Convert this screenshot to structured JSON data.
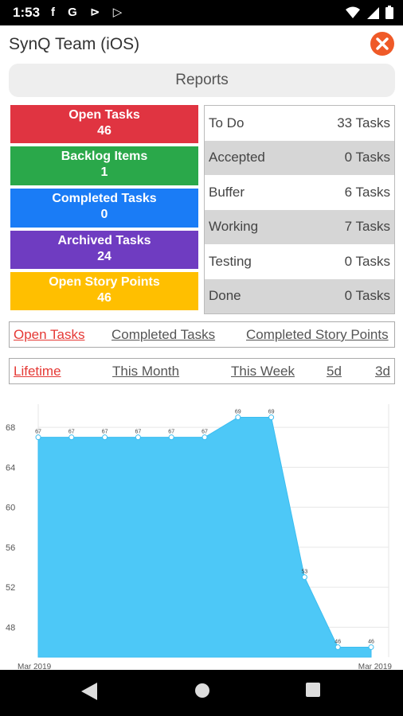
{
  "statusbar": {
    "time": "1:53",
    "icons": [
      "facebook-icon",
      "g-icon",
      "send-icon",
      "play-icon"
    ],
    "notif_glyphs": "f G ⊳ ▷"
  },
  "header": {
    "title": "SynQ Team (iOS)",
    "reports_label": "Reports"
  },
  "tiles": [
    {
      "label": "Open Tasks",
      "value": "46",
      "color": "#e03441"
    },
    {
      "label": "Backlog Items",
      "value": "1",
      "color": "#2aa84a"
    },
    {
      "label": "Completed Tasks",
      "value": "0",
      "color": "#1a7cf6"
    },
    {
      "label": "Archived Tasks",
      "value": "24",
      "color": "#6f3cc1"
    },
    {
      "label": "Open Story Points",
      "value": "46",
      "color": "#ffbf00"
    }
  ],
  "status_rows": [
    {
      "name": "To Do",
      "count": "33 Tasks"
    },
    {
      "name": "Accepted",
      "count": "0 Tasks"
    },
    {
      "name": "Buffer",
      "count": "6 Tasks"
    },
    {
      "name": "Working",
      "count": "7 Tasks"
    },
    {
      "name": "Testing",
      "count": "0 Tasks"
    },
    {
      "name": "Done",
      "count": "0 Tasks"
    }
  ],
  "metric_tabs": [
    "Open Tasks",
    "Completed Tasks",
    "Completed Story Points"
  ],
  "range_tabs": [
    "Lifetime",
    "This Month",
    "This Week",
    "5d",
    "3d"
  ],
  "active_color": "#e53935",
  "chart_data": {
    "type": "area",
    "x": [
      1,
      2,
      3,
      4,
      5,
      6,
      7,
      8,
      9,
      10,
      11
    ],
    "values": [
      67,
      67,
      67,
      67,
      67,
      67,
      69,
      69,
      53,
      46,
      46
    ],
    "xlabels": [
      "Mar 2019",
      "Mar 2019"
    ],
    "yticks": [
      48,
      52,
      56,
      60,
      64,
      68
    ],
    "ylim": [
      45,
      70
    ],
    "grid": true,
    "fill_color": "#4dc8f7"
  }
}
